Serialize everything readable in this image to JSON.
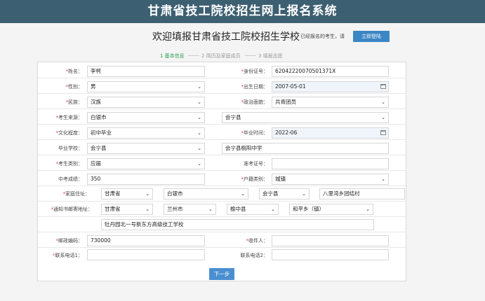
{
  "header": {
    "title": "甘肃省技工院校招生网上报名系统"
  },
  "welcome": {
    "title": "欢迎填报甘肃省技工院校招生学校",
    "registered_tip": "已经报名的考生，请",
    "login_button": "立即登陆"
  },
  "steps": [
    {
      "label": "1 基本信息"
    },
    {
      "label": "2 简历及家庭成员"
    },
    {
      "label": "3 填报志愿"
    }
  ],
  "form": {
    "required_mark": "*",
    "name": {
      "label": "姓名：",
      "value": "李柯"
    },
    "id_card": {
      "label": "身份证号：",
      "value": "62042220070501371X"
    },
    "gender": {
      "label": "性别：",
      "value": "男"
    },
    "birth_date": {
      "label": "出生日期：",
      "value": "2007-05-01"
    },
    "ethnicity": {
      "label": "民族：",
      "value": "汉族"
    },
    "political_status": {
      "label": "政治面貌：",
      "value": "共青团员"
    },
    "origin": {
      "label": "考生来源：",
      "value_city": "白银市",
      "value_county": "会宁县"
    },
    "education": {
      "label": "文化程度：",
      "value": "初中毕业"
    },
    "graduation_time": {
      "label": "毕业时间：",
      "value": "2022-06"
    },
    "school": {
      "label": "毕业学校：",
      "value_county": "会宁县",
      "value_school": "会宁县桃阳中学"
    },
    "candidate_type": {
      "label": "考生类别：",
      "value": "应届"
    },
    "exam_number": {
      "label": "准考证号：",
      "value": ""
    },
    "exam_score": {
      "label": "中考成绩：",
      "value": "350"
    },
    "household_type": {
      "label": "户籍类别：",
      "value": "城镇"
    },
    "home_address": {
      "label": "家庭住址：",
      "province": "甘肃省",
      "city": "白银市",
      "county": "会宁县",
      "detail": "八里湾乡团结村"
    },
    "mail_address": {
      "label": "通知书邮寄地址：",
      "province": "甘肃省",
      "city": "兰州市",
      "county": "榆中县",
      "town": "和平乡（镇）",
      "detail": "牡丹园北一号新东方高级技工学校"
    },
    "postal_code": {
      "label": "邮政编码：",
      "value": "730000"
    },
    "recipient": {
      "label": "收件人：",
      "value": ""
    },
    "phone1": {
      "label": "联系电话1：",
      "value": ""
    },
    "phone2": {
      "label": "联系电话2：",
      "value": ""
    }
  },
  "next_button": "下一步"
}
